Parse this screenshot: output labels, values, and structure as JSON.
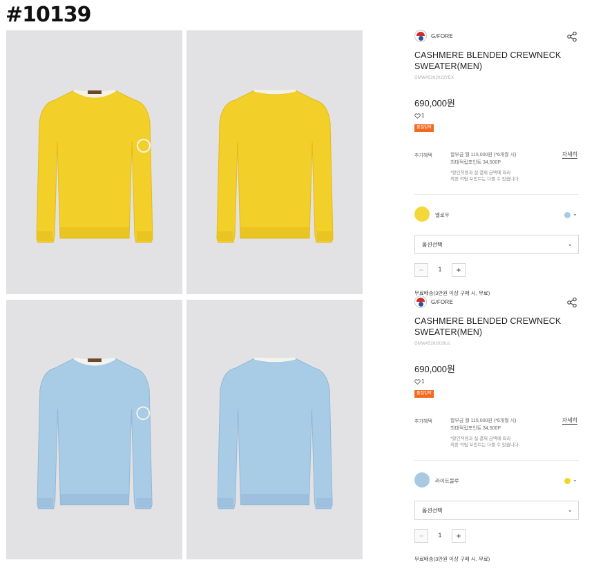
{
  "page_tag": "#10139",
  "products": [
    {
      "brand": "G/FORE",
      "title": "CASHMERE BLENDED CREWNECK SWEATER(MEN)",
      "sku": "GMWA5262022YEX",
      "price": "690,000원",
      "likes": "1",
      "badge": "품절임박",
      "benefit_label": "추가혜택",
      "benefit_line1": "할부금 월 115,000원 (*6개월 시)",
      "benefit_line2": "최대적립포인트 34,500P",
      "benefit_note1": "*할인적용과 실 결제 금액에 따라",
      "benefit_note2": "최종 적립 포인트는 다를 수 있습니다.",
      "detail_link": "자세히",
      "color_name": "옐로우",
      "swatch_color": "#f4d83a",
      "alt_color": "#a9c8e2",
      "option_placeholder": "옵션선택",
      "quantity": "1",
      "shipping": "무료배송(3만원 이상 구매 시, 무료)"
    },
    {
      "brand": "G/FORE",
      "title": "CASHMERE BLENDED CREWNECK SWEATER(MEN)",
      "sku": "GMWA5262028UL",
      "price": "690,000원",
      "likes": "1",
      "badge": "품절임박",
      "benefit_label": "추가혜택",
      "benefit_line1": "할부금 월 115,000원 (*6개월 시)",
      "benefit_line2": "최대적립포인트 34,500P",
      "benefit_note1": "*할인적용과 실 결제 금액에 따라",
      "benefit_note2": "최종 적립 포인트는 다를 수 있습니다.",
      "detail_link": "자세히",
      "color_name": "라이트블루",
      "swatch_color": "#a9c8e2",
      "alt_color": "#f0d526",
      "option_placeholder": "옵션선택",
      "quantity": "1",
      "shipping": "무료배송(3만원 이상 구매 시, 무료)"
    }
  ],
  "photos": [
    {
      "view": "front",
      "color": "yellow",
      "fill": "#f3cf2a",
      "shade": "#e2bb1c",
      "trim": "#f4f1e6"
    },
    {
      "view": "back",
      "color": "yellow",
      "fill": "#f3cf2a",
      "shade": "#e2bb1c",
      "trim": "#f4f1e6"
    },
    {
      "view": "front",
      "color": "light-blue",
      "fill": "#a8cbe6",
      "shade": "#92b8d6",
      "trim": "#f3f3ef"
    },
    {
      "view": "back",
      "color": "light-blue",
      "fill": "#a8cbe6",
      "shade": "#92b8d6",
      "trim": "#f3f3ef"
    }
  ]
}
